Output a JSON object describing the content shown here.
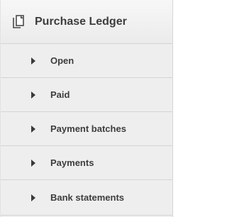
{
  "header": {
    "title": "Purchase Ledger",
    "icon": "copy-icon"
  },
  "nav": {
    "items": [
      {
        "label": "Open",
        "icon": "caret-right-icon"
      },
      {
        "label": "Paid",
        "icon": "caret-right-icon"
      },
      {
        "label": "Payment batches",
        "icon": "caret-right-icon"
      },
      {
        "label": "Payments",
        "icon": "caret-right-icon"
      },
      {
        "label": "Bank statements",
        "icon": "caret-right-icon"
      }
    ]
  },
  "colors": {
    "panel_bg": "#eeeeee",
    "header_bg": "#f2f2f2",
    "text": "#3d3d3d",
    "divider": "#d4d4d4"
  }
}
